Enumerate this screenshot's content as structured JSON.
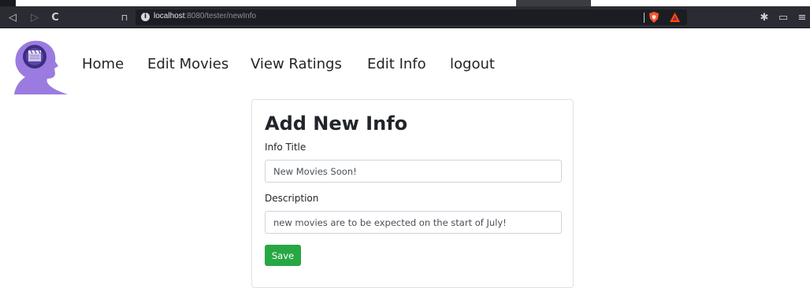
{
  "browser": {
    "url_host": "localhost",
    "url_rest": ":8080/tester/newInfo",
    "nav_back_glyph": "◁",
    "nav_forward_glyph": "▷",
    "reload_glyph": "C",
    "bookmark_glyph": "⊓",
    "extensions_glyph": "✱",
    "wallet_glyph": "▭",
    "menu_glyph": "≡",
    "icons": [
      "back-icon",
      "forward-icon",
      "reload-icon",
      "bookmark-icon",
      "info-icon",
      "brave-shield-icon",
      "brave-rewards-icon",
      "extensions-icon",
      "wallet-icon",
      "menu-icon"
    ]
  },
  "nav": {
    "links": [
      "Home",
      "Edit Movies",
      "View Ratings",
      "Edit Info",
      "logout"
    ]
  },
  "form": {
    "title": "Add New Info",
    "info_title_label": "Info Title",
    "info_title_value": "New Movies Soon!",
    "description_label": "Description",
    "description_value": "new movies are to be expected on the start of July!",
    "save_label": "Save"
  },
  "colors": {
    "save_button": "#28a745",
    "logo_purple": "#9b7be0",
    "chrome_bg": "#2b2c33"
  }
}
